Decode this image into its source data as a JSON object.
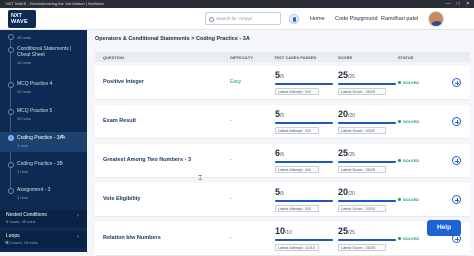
{
  "window": {
    "title": "NXT WAVE - Revolutionizing the Job Market | NxtWave",
    "controls": [
      "—",
      "□",
      "✕"
    ]
  },
  "header": {
    "logo_line1": "NXT",
    "logo_line2": "WAVE",
    "search_placeholder": "Search for 'Arrays'",
    "nav": {
      "home": "Home",
      "code_playground": "Code Playground",
      "user_name": "Ramdhari patel"
    }
  },
  "sidebar": {
    "items": [
      {
        "label": "",
        "sub": "45 mins"
      },
      {
        "label": "Conditional Statements | Cheat Sheet",
        "sub": "10 mins"
      },
      {
        "label": "MCQ Practice 4",
        "sub": "30 mins"
      },
      {
        "label": "MCQ Practice 5",
        "sub": "30 mins"
      },
      {
        "label": "Coding Practice - 3A",
        "sub": "1 hour"
      },
      {
        "label": "Coding Practice - 3B",
        "sub": "1 hour"
      },
      {
        "label": "Assignment - 3",
        "sub": "1 hour"
      }
    ],
    "sections": [
      {
        "label": "Nested Conditions",
        "sub": "8 hours, 45 mins"
      },
      {
        "label": "Loops",
        "sub": "13 hours, 18 mins"
      }
    ],
    "collapse_label": "«"
  },
  "main": {
    "breadcrumb": "Operators & Conditional Statements > Coding Practice - 3A",
    "columns": {
      "question": "QUESTION",
      "difficulty": "DIFFICULTY",
      "test_cases": "TEST CASES PASSED",
      "score": "SCORE",
      "status": "STATUS"
    },
    "rows": [
      {
        "question": "Positive Integer",
        "difficulty": "Easy",
        "tc": "5",
        "tc_total": "/5",
        "score": "25",
        "score_total": "/25",
        "tc_latest": "Latest Attempt : 5/5",
        "score_latest": "Latest Score : 25/25",
        "status": "SOLVED",
        "tc_pct": 1.0,
        "score_pct": 1.0
      },
      {
        "question": "Exam Result",
        "difficulty": "-",
        "tc": "5",
        "tc_total": "/5",
        "score": "20",
        "score_total": "/20",
        "tc_latest": "Latest Attempt : 5/5",
        "score_latest": "Latest Score : 20/20",
        "status": "SOLVED",
        "tc_pct": 1.0,
        "score_pct": 1.0
      },
      {
        "question": "Greatest Among Two Numbers - 3",
        "difficulty": "-",
        "tc": "6",
        "tc_total": "/6",
        "score": "25",
        "score_total": "/25",
        "tc_latest": "Latest Attempt : 6/6",
        "score_latest": "Latest Score : 25/25",
        "status": "SOLVED",
        "tc_pct": 1.0,
        "score_pct": 1.0
      },
      {
        "question": "Vote Eligibility",
        "difficulty": "-",
        "tc": "5",
        "tc_total": "/5",
        "score": "20",
        "score_total": "/20",
        "tc_latest": "Latest Attempt : 5/5",
        "score_latest": "Latest Score : 20/20",
        "status": "SOLVED",
        "tc_pct": 1.0,
        "score_pct": 1.0
      },
      {
        "question": "Relation b/w Numbers",
        "difficulty": "-",
        "tc": "10",
        "tc_total": "/10",
        "score": "25",
        "score_total": "/25",
        "tc_latest": "Latest Attempt : 10/10",
        "score_latest": "Latest Score : 25/25",
        "status": "SOLVED",
        "tc_pct": 1.0,
        "score_pct": 1.0
      }
    ]
  },
  "help_label": "Help",
  "colors": {
    "sidebar": "#0d2b52",
    "accent": "#1e63d6",
    "solved": "#1aa05b"
  }
}
